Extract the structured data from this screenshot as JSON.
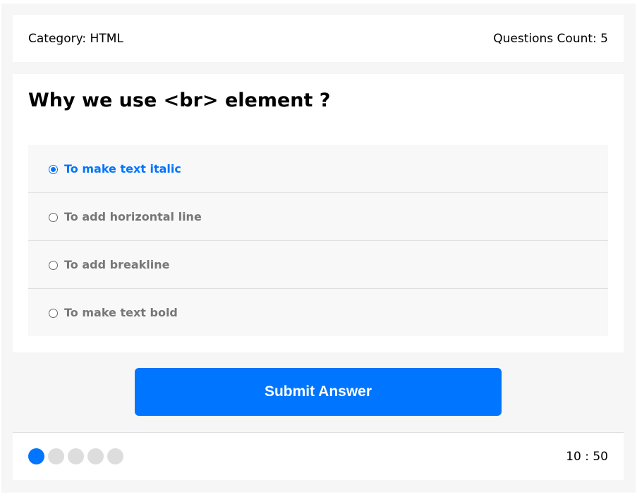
{
  "info": {
    "category_label": "Category: HTML",
    "count_label": "Questions Count: 5"
  },
  "question": {
    "title": "Why we use <br> element ?",
    "answers": [
      {
        "label": "To make text italic",
        "selected": true
      },
      {
        "label": "To add horizontal line",
        "selected": false
      },
      {
        "label": "To add breakline",
        "selected": false
      },
      {
        "label": "To make text bold",
        "selected": false
      }
    ]
  },
  "submit_label": "Submit Answer",
  "progress": {
    "total": 5,
    "current": 1
  },
  "countdown": "10 : 50",
  "colors": {
    "accent": "#0075ff",
    "inactive_bullet": "#dddddd",
    "panel_bg": "#f6f6f6"
  }
}
